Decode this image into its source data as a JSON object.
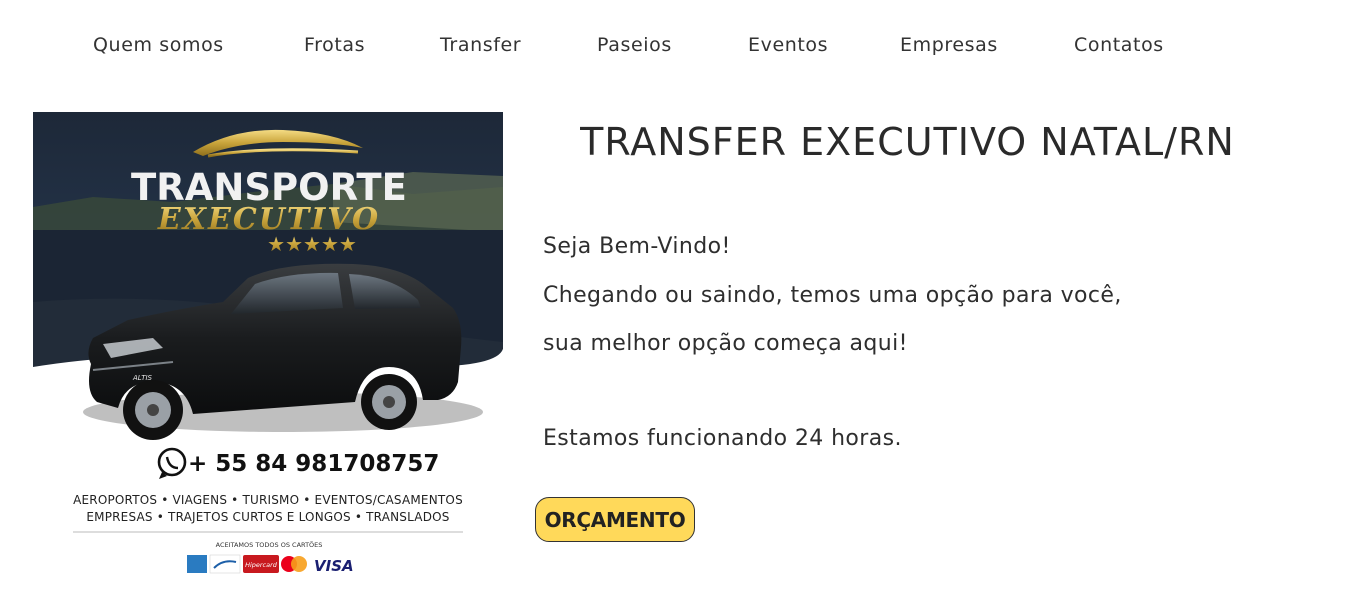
{
  "nav": {
    "items": [
      {
        "label": "Quem somos"
      },
      {
        "label": "Frotas"
      },
      {
        "label": "Transfer"
      },
      {
        "label": "Paseios"
      },
      {
        "label": "Eventos"
      },
      {
        "label": "Empresas"
      },
      {
        "label": "Contatos"
      }
    ]
  },
  "promo": {
    "brand_line1": "TRANSPORTE",
    "brand_line2": "EXECUTIVO",
    "stars": "★★★★★",
    "phone": "+ 55 84 981708757",
    "services_line1": "AEROPORTOS • VIAGENS • TURISMO • EVENTOS/CASAMENTOS",
    "services_line2": "EMPRESAS • TRAJETOS CURTOS E LONGOS • TRANSLADOS",
    "cards_caption": "ACEITAMOS TODOS OS CARTÕES",
    "card_labels": [
      "Hipercard",
      "VISA"
    ],
    "car_model": "ALTIS"
  },
  "hero": {
    "title": "TRANSFER EXECUTIVO NATAL/RN",
    "line1": "Seja Bem-Vindo!",
    "line2": "Chegando ou saindo, temos uma opção para você,",
    "line3": "sua melhor opção começa aqui!",
    "line4": "Estamos funcionando 24 horas.",
    "cta_label": "ORÇAMENTO"
  },
  "colors": {
    "cta_bg": "#ffd95a",
    "gold": "#c9a43b",
    "night_sky": "#1e2a3a"
  }
}
